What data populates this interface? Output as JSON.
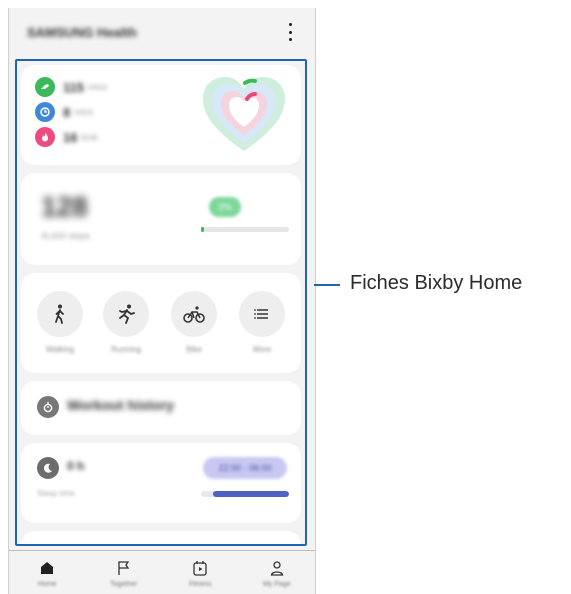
{
  "header": {
    "app_title": "SAMSUNG Health"
  },
  "activity": {
    "rows": [
      {
        "value": "115",
        "unit": "mins",
        "color": "#3cb95b",
        "icon": "running-shoe-icon"
      },
      {
        "value": "8",
        "unit": "mins",
        "color": "#3f88d6",
        "icon": "clock-icon"
      },
      {
        "value": "16",
        "unit": "kcal",
        "color": "#ec4d7e",
        "icon": "flame-icon"
      }
    ]
  },
  "steps": {
    "count": "128",
    "subtitle": "/6,000 steps",
    "goal_badge": "2%",
    "progress": 0.02
  },
  "quick_actions": [
    {
      "label": "Walking",
      "icon": "walking-icon"
    },
    {
      "label": "Running",
      "icon": "running-icon"
    },
    {
      "label": "Bike",
      "icon": "bike-icon"
    },
    {
      "label": "More",
      "icon": "list-icon"
    }
  ],
  "workout_history": {
    "title": "Workout history"
  },
  "sleep": {
    "value": "0 h",
    "subtitle": "Sleep time",
    "badge": "22:00 - 06:00"
  },
  "nav": [
    {
      "label": "Home",
      "icon": "home-icon"
    },
    {
      "label": "Together",
      "icon": "flag-icon"
    },
    {
      "label": "Fitness",
      "icon": "calendar-play-icon"
    },
    {
      "label": "My Page",
      "icon": "person-icon"
    }
  ],
  "callout": {
    "text": "Fiches Bixby Home",
    "color": "#1f63b5"
  }
}
